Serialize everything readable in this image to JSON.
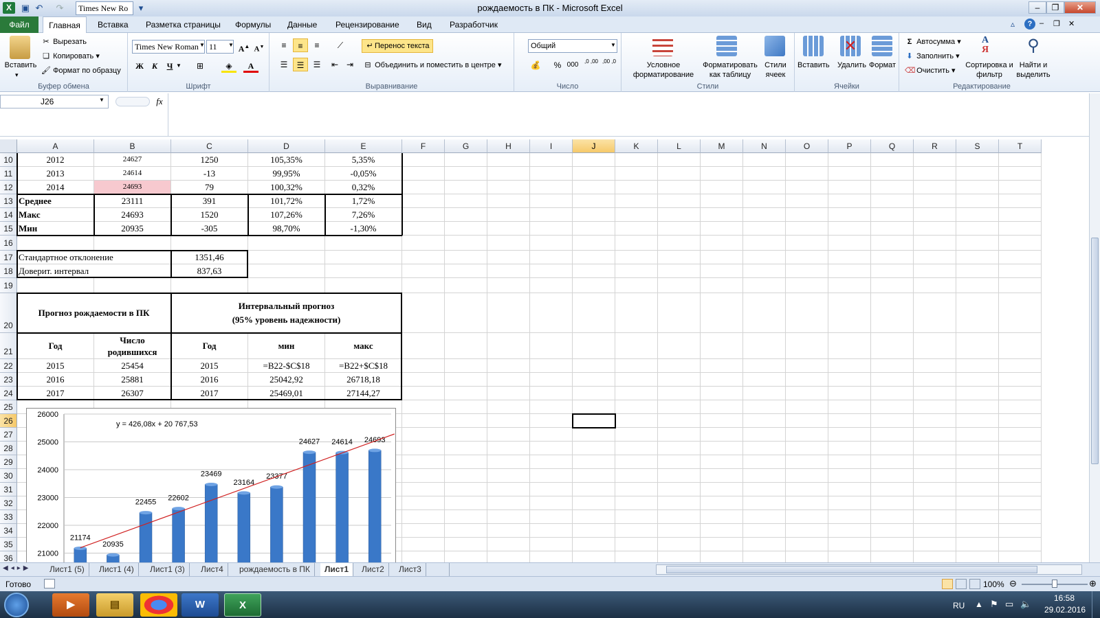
{
  "window": {
    "title": "рождаемость в ПК  -  Microsoft Excel",
    "quick_font": "Times New Ro"
  },
  "tabs": {
    "file": "Файл",
    "items": [
      "Главная",
      "Вставка",
      "Разметка страницы",
      "Формулы",
      "Данные",
      "Рецензирование",
      "Вид",
      "Разработчик"
    ]
  },
  "ribbon": {
    "clipboard": {
      "paste": "Вставить",
      "cut": "Вырезать",
      "copy": "Копировать",
      "format_painter": "Формат по образцу",
      "label": "Буфер обмена"
    },
    "font": {
      "name": "Times New Roman",
      "size": "11",
      "bold": "Ж",
      "italic": "К",
      "underline": "Ч",
      "label": "Шрифт"
    },
    "alignment": {
      "wrap": "Перенос текста",
      "merge": "Объединить и поместить в центре",
      "label": "Выравнивание"
    },
    "number": {
      "format": "Общий",
      "percent": "%",
      "thousands": "000",
      "inc_decimal": ",0 ,00",
      "dec_decimal": ",00 ,0",
      "label": "Число"
    },
    "styles": {
      "conditional": "Условное форматирование",
      "as_table": "Форматировать как таблицу",
      "cell_styles": "Стили ячеек",
      "label": "Стили"
    },
    "cells": {
      "insert": "Вставить",
      "delete": "Удалить",
      "format": "Формат",
      "label": "Ячейки"
    },
    "editing": {
      "autosum": "Автосумма",
      "fill": "Заполнить",
      "clear": "Очистить",
      "sort": "Сортировка и фильтр",
      "find": "Найти и выделить",
      "label": "Редактирование"
    }
  },
  "formula_bar": {
    "name_box": "J26",
    "fx": "fx",
    "value": ""
  },
  "columns": [
    "A",
    "B",
    "C",
    "D",
    "E",
    "F",
    "G",
    "H",
    "I",
    "J",
    "K",
    "L",
    "M",
    "N",
    "O",
    "P",
    "Q",
    "R",
    "S",
    "T"
  ],
  "rows": [
    "10",
    "11",
    "12",
    "13",
    "14",
    "15",
    "16",
    "17",
    "18",
    "19",
    "20",
    "21",
    "22",
    "23",
    "24",
    "25",
    "26",
    "27",
    "28",
    "29",
    "30",
    "31",
    "32",
    "33",
    "34",
    "35",
    "36"
  ],
  "table_years": [
    {
      "a": "2012",
      "b": "24627",
      "c": "1250",
      "d": "105,35%",
      "e": "5,35%"
    },
    {
      "a": "2013",
      "b": "24614",
      "c": "-13",
      "d": "99,95%",
      "e": "-0,05%"
    },
    {
      "a": "2014",
      "b": "24693",
      "c": "79",
      "d": "100,32%",
      "e": "0,32%"
    }
  ],
  "table_stats": [
    {
      "a": "Среднее",
      "b": "23111",
      "c": "391",
      "d": "101,72%",
      "e": "1,72%"
    },
    {
      "a": "Макс",
      "b": "24693",
      "c": "1520",
      "d": "107,26%",
      "e": "7,26%"
    },
    {
      "a": "Мин",
      "b": "20935",
      "c": "-305",
      "d": "98,70%",
      "e": "-1,30%"
    }
  ],
  "deviation": {
    "std_label": "Стандартное отклонение",
    "std_value": "1351,46",
    "ci_label": "Доверит. интервал",
    "ci_value": "837,63"
  },
  "forecast": {
    "title_left": "Прогноз рождаемости в ПК",
    "title_right_1": "Интервальный прогноз",
    "title_right_2": "(95% уровень надежности)",
    "h_year": "Год",
    "h_births": "Число родившихся",
    "h_year2": "Год",
    "h_min": "мин",
    "h_max": "макс",
    "rows": [
      {
        "year": "2015",
        "births": "25454",
        "year2": "2015",
        "min": "=B22-$C$18",
        "max": "=B22+$C$18"
      },
      {
        "year": "2016",
        "births": "25881",
        "year2": "2016",
        "min": "25042,92",
        "max": "26718,18"
      },
      {
        "year": "2017",
        "births": "26307",
        "year2": "2017",
        "min": "25469,01",
        "max": "27144,27"
      }
    ]
  },
  "chart_data": {
    "type": "bar",
    "values": [
      21174,
      20935,
      22455,
      22602,
      23469,
      23164,
      23377,
      24627,
      24614,
      24693
    ],
    "y_ticks": [
      "26000",
      "25000",
      "24000",
      "23000",
      "22000",
      "21000"
    ],
    "ylim": [
      20800,
      26000
    ],
    "trendline": {
      "slope": 426.08,
      "intercept": 20767.53
    },
    "equation": "y = 426,08x + 20 767,53",
    "bar_color": "#3a78c8",
    "trend_color": "#d02020"
  },
  "sheets": [
    "Лист1 (5)",
    "Лист1 (4)",
    "Лист1 (3)",
    "Лист4",
    "рождаемость в ПК",
    "Лист1",
    "Лист2",
    "Лист3"
  ],
  "active_sheet": "Лист1",
  "status": {
    "ready": "Готово",
    "zoom": "100%"
  },
  "taskbar": {
    "lang": "RU",
    "time": "16:58",
    "date": "29.02.2016"
  }
}
